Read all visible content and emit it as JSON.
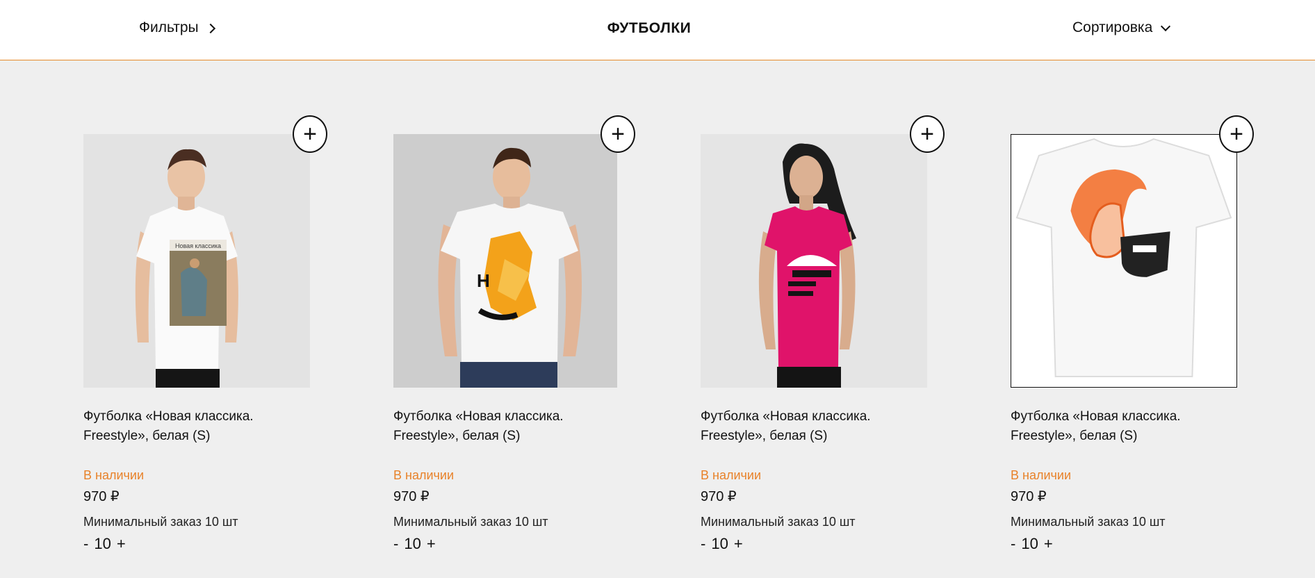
{
  "header": {
    "filters_label": "Фильтры",
    "title": "ФУТБОЛКИ",
    "sort_label": "Сортировка"
  },
  "products": [
    {
      "name": "Футболка «Новая классика. Freestyle», белая (S)",
      "stock": "В наличии",
      "price": "970 ₽",
      "min_order": "Минимальный заказ 10 шт",
      "qty_minus": "-",
      "qty_value": "10",
      "qty_plus": "+",
      "add_label": "+",
      "print_text": "Новая классика"
    },
    {
      "name": "Футболка «Новая классика. Freestyle», белая (S)",
      "stock": "В наличии",
      "price": "970 ₽",
      "min_order": "Минимальный заказ 10 шт",
      "qty_minus": "-",
      "qty_value": "10",
      "qty_plus": "+",
      "add_label": "+"
    },
    {
      "name": "Футболка «Новая классика. Freestyle», белая (S)",
      "stock": "В наличии",
      "price": "970 ₽",
      "min_order": "Минимальный заказ 10 шт",
      "qty_minus": "-",
      "qty_value": "10",
      "qty_plus": "+",
      "add_label": "+"
    },
    {
      "name": "Футболка «Новая классика. Freestyle», белая (S)",
      "stock": "В наличии",
      "price": "970 ₽",
      "min_order": "Минимальный заказ 10 шт",
      "qty_minus": "-",
      "qty_value": "10",
      "qty_plus": "+",
      "add_label": "+"
    }
  ],
  "colors": {
    "accent": "#e8822a",
    "page_bg": "#efefef",
    "header_border": "#e58a2a"
  }
}
